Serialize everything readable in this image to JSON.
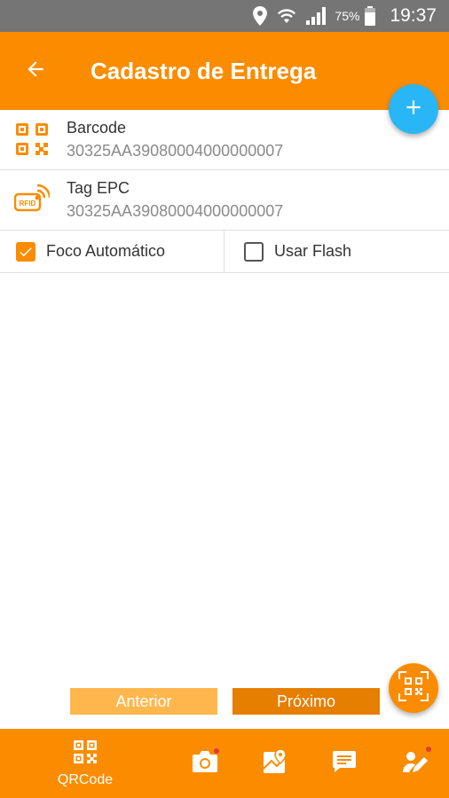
{
  "status_bar": {
    "icons": [
      "location-icon",
      "wifi-icon",
      "signal-icon",
      "battery-icon"
    ],
    "battery": "75%",
    "time": "19:37"
  },
  "app_bar": {
    "title": "Cadastro de Entrega",
    "back_icon": "arrow-left-icon",
    "fab_icon": "plus-icon"
  },
  "fields": [
    {
      "label": "Barcode",
      "value": "30325AA39080004000000007",
      "icon": "qr-code-icon"
    },
    {
      "label": "Tag EPC",
      "value": "30325AA39080004000000007",
      "icon": "rfid-icon"
    }
  ],
  "options": [
    {
      "label": "Foco Automático",
      "checked": true
    },
    {
      "label": "Usar Flash",
      "checked": false
    }
  ],
  "buttons": {
    "previous": "Anterior",
    "next": "Próximo"
  },
  "bottom_nav": {
    "qr_label": "QRCode",
    "items": [
      "qr-code-icon",
      "camera-icon",
      "map-icon",
      "message-icon",
      "signature-icon"
    ]
  },
  "colors": {
    "primary": "#fb8c00",
    "accent": "#29b6f6",
    "status_bar": "#757575"
  }
}
